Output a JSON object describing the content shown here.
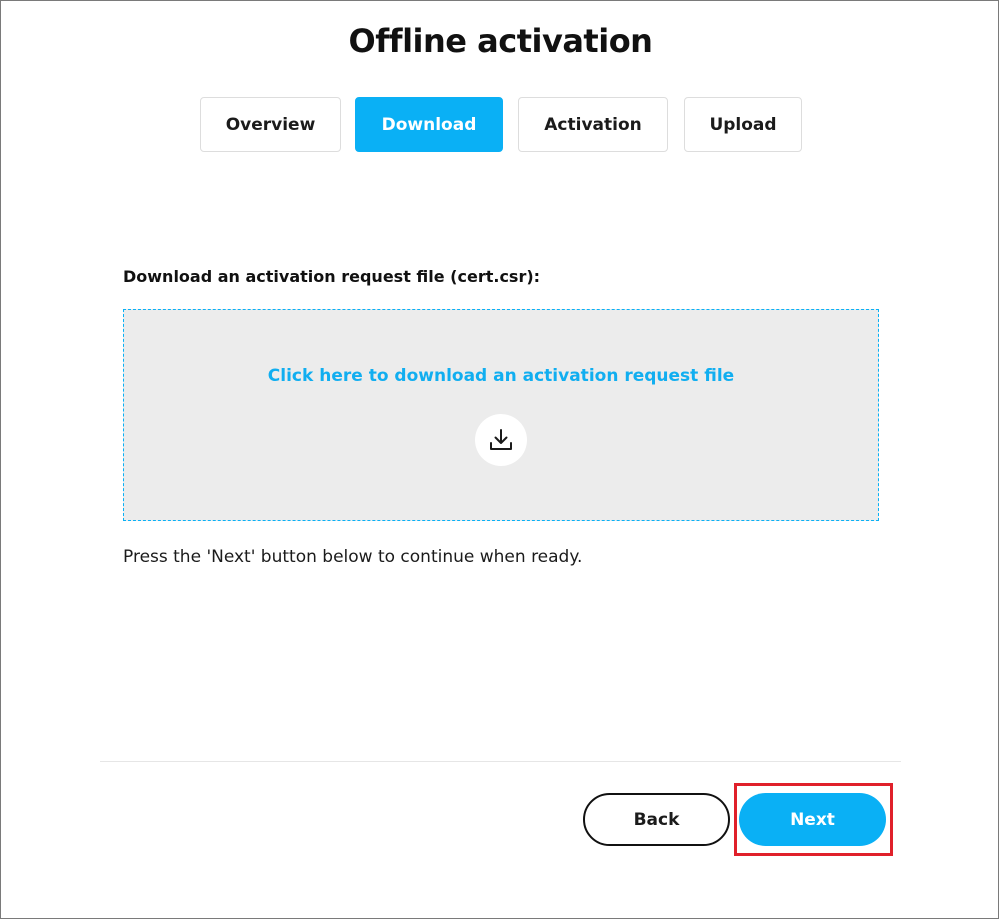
{
  "page": {
    "title": "Offline activation"
  },
  "tabs": [
    {
      "label": "Overview",
      "active": false
    },
    {
      "label": "Download",
      "active": true
    },
    {
      "label": "Activation",
      "active": false
    },
    {
      "label": "Upload",
      "active": false
    }
  ],
  "download": {
    "heading": "Download an activation request file (cert.csr):",
    "link_text": "Click here to download an activation request file",
    "icon": "download-icon"
  },
  "hint": "Press the 'Next' button below to continue when ready.",
  "footer": {
    "back_label": "Back",
    "next_label": "Next"
  },
  "colors": {
    "accent": "#0ab0f5",
    "highlight": "#e0202a",
    "dropzone_bg": "#ececec"
  }
}
